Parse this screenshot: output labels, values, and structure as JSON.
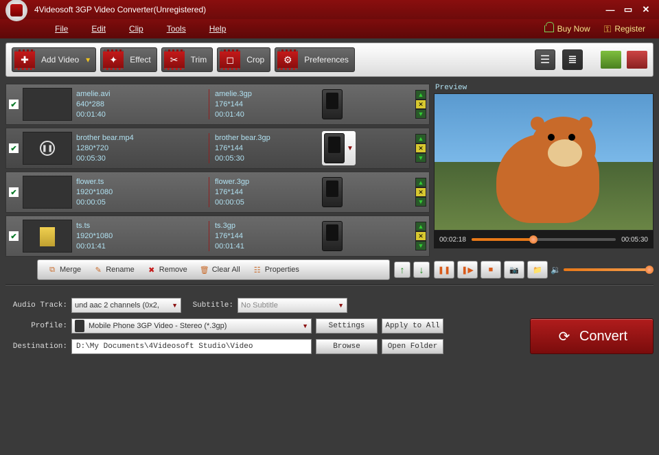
{
  "titlebar": {
    "title": "4Videosoft 3GP Video Converter(Unregistered)"
  },
  "menu": {
    "file": "File",
    "edit": "Edit",
    "clip": "Clip",
    "tools": "Tools",
    "help": "Help",
    "buy": "Buy Now",
    "register": "Register"
  },
  "toolbar": {
    "addvideo": "Add Video",
    "effect": "Effect",
    "trim": "Trim",
    "crop": "Crop",
    "prefs": "Preferences"
  },
  "files": [
    {
      "src": "amelie.avi",
      "sres": "640*288",
      "sdur": "00:01:40",
      "out": "amelie.3gp",
      "ores": "176*144",
      "odur": "00:01:40"
    },
    {
      "src": "brother bear.mp4",
      "sres": "1280*720",
      "sdur": "00:05:30",
      "out": "brother bear.3gp",
      "ores": "176*144",
      "odur": "00:05:30"
    },
    {
      "src": "flower.ts",
      "sres": "1920*1080",
      "sdur": "00:00:05",
      "out": "flower.3gp",
      "ores": "176*144",
      "odur": "00:00:05"
    },
    {
      "src": "ts.ts",
      "sres": "1920*1080",
      "sdur": "00:01:41",
      "out": "ts.3gp",
      "ores": "176*144",
      "odur": "00:01:41"
    }
  ],
  "actions": {
    "merge": "Merge",
    "rename": "Rename",
    "remove": "Remove",
    "clearall": "Clear All",
    "properties": "Properties"
  },
  "preview": {
    "label": "Preview",
    "cur": "00:02:18",
    "total": "00:05:30"
  },
  "settings": {
    "audioTrackLabel": "Audio Track:",
    "audioTrack": "und aac 2 channels (0x2,",
    "subtitleLabel": "Subtitle:",
    "subtitle": "No Subtitle",
    "profileLabel": "Profile:",
    "profile": "Mobile Phone 3GP Video - Stereo (*.3gp)",
    "destLabel": "Destination:",
    "dest": "D:\\My Documents\\4Videosoft Studio\\Video",
    "settingsBtn": "Settings",
    "applyAll": "Apply to All",
    "browse": "Browse",
    "openFolder": "Open Folder"
  },
  "convert": "Convert"
}
